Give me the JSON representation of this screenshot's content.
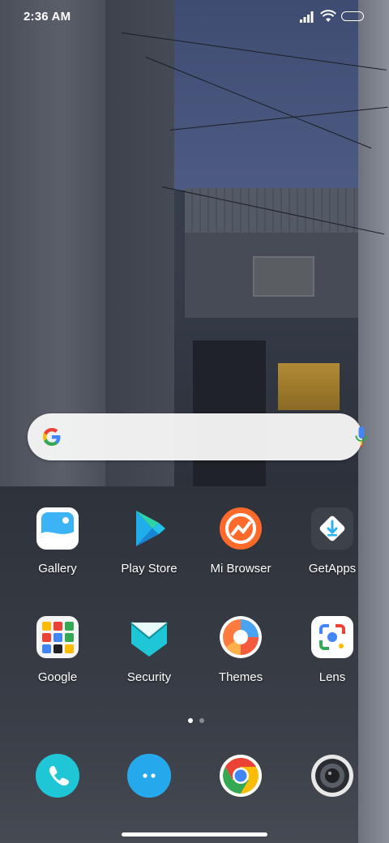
{
  "status_bar": {
    "time": "2:36 AM"
  },
  "search": {
    "provider": "Google"
  },
  "apps": [
    {
      "label": "Gallery",
      "icon": "gallery-icon"
    },
    {
      "label": "Play Store",
      "icon": "play-store-icon"
    },
    {
      "label": "Mi Browser",
      "icon": "mi-browser-icon"
    },
    {
      "label": "GetApps",
      "icon": "getapps-icon"
    },
    {
      "label": "Google",
      "icon": "google-folder-icon"
    },
    {
      "label": "Security",
      "icon": "security-icon"
    },
    {
      "label": "Themes",
      "icon": "themes-icon"
    },
    {
      "label": "Lens",
      "icon": "lens-icon"
    }
  ],
  "dock": [
    "phone-icon",
    "messages-icon",
    "chrome-icon",
    "camera-icon"
  ],
  "page_indicator": {
    "pages": 2,
    "current": 1
  },
  "colors": {
    "accent_teal": "#1fc6d6",
    "mi_orange": "#ff6a2b",
    "getapps_blue": "#2cb2ef"
  }
}
